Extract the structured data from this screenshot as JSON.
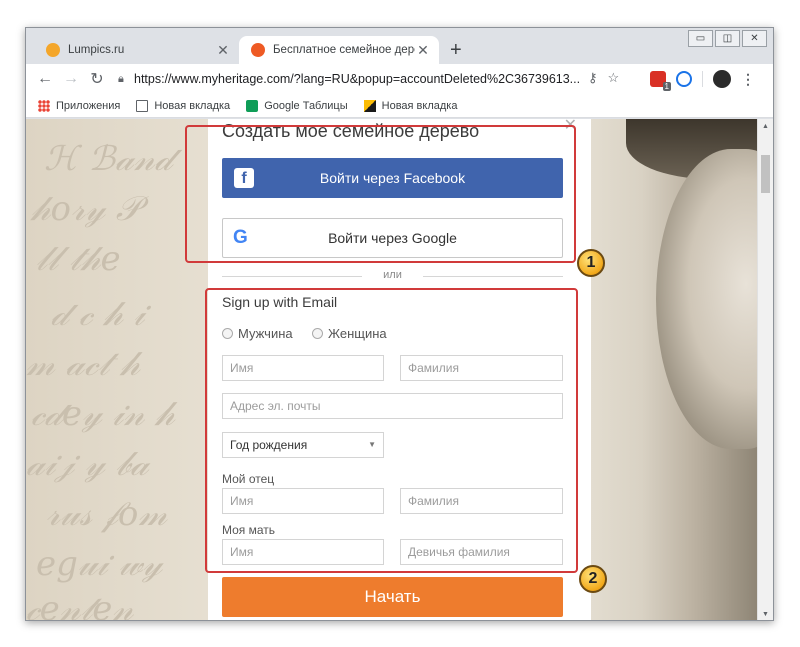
{
  "browser": {
    "tabs": [
      {
        "title": "Lumpics.ru",
        "favicon_color": "#f4a62a"
      },
      {
        "title": "Бесплатное семейное дерево, Г",
        "favicon_color": "#ee5a24"
      }
    ],
    "new_tab_symbol": "+",
    "window_controls": [
      "▭",
      "◫",
      "✕"
    ],
    "url": "https://www.myheritage.com/?lang=RU&popup=accountDeleted%2C36739613...",
    "extension_badge": "1",
    "bookmarks": [
      {
        "label": "Приложения",
        "icon": "apps-icon"
      },
      {
        "label": "Новая вкладка",
        "icon": "page-icon"
      },
      {
        "label": "Google Таблицы",
        "icon": "sheets-icon"
      },
      {
        "label": "Новая вкладка",
        "icon": "image-icon"
      }
    ]
  },
  "form": {
    "title": "Создать мое семейное дерево",
    "facebook_button": "Войти через Facebook",
    "google_button": "Войти через Google",
    "divider": "или",
    "signup_title": "Sign up with Email",
    "gender_male": "Мужчина",
    "gender_female": "Женщина",
    "first_name_placeholder": "Имя",
    "last_name_placeholder": "Фамилия",
    "email_placeholder": "Адрес эл. почты",
    "birth_year": "Год рождения",
    "father_label": "Мой отец",
    "father_first_placeholder": "Имя",
    "father_last_placeholder": "Фамилия",
    "mother_label": "Моя мать",
    "mother_first_placeholder": "Имя",
    "mother_last_placeholder": "Девичья фамилия",
    "start_button": "Начать"
  },
  "annotations": {
    "callout_1": "1",
    "callout_2": "2",
    "highlight_color": "#d13a3a"
  },
  "colors": {
    "facebook": "#4064ad",
    "start": "#ee7c2d"
  }
}
